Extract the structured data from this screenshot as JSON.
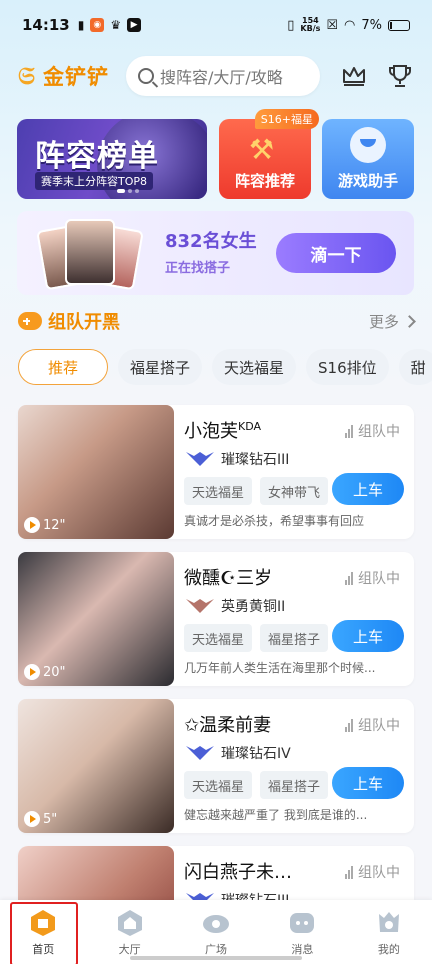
{
  "status_bar": {
    "time": "14:13",
    "speed_top": "154",
    "speed_bottom": "KB/s",
    "battery": "7%"
  },
  "header": {
    "app_name": "金铲铲",
    "search_placeholder": "搜阵容/大厅/攻略",
    "icons": [
      "crown-icon",
      "trophy-icon"
    ]
  },
  "banners": {
    "main_title": "阵容榜单",
    "main_sub": "赛季末上分阵容TOP8",
    "red_tag": "S16+福星",
    "red_label": "阵容推荐",
    "blue_label": "游戏助手"
  },
  "girls_card": {
    "count": "832名女生",
    "subtitle": "正在找搭子",
    "button": "滴一下"
  },
  "section": {
    "title": "组队开黑",
    "more": "更多"
  },
  "tabs": [
    "推荐",
    "福星搭子",
    "天选福星",
    "S16排位",
    "甜"
  ],
  "players": [
    {
      "name": "小泡芙",
      "name_sup": "KDA",
      "status": "组队中",
      "rank": "璀璨钻石III",
      "rank_color": "#4b5fd6",
      "chips": [
        "天选福星",
        "女神带飞"
      ],
      "button": "上车",
      "bio": "真诚才是必杀技，希望事事有回应",
      "duration": "12\""
    },
    {
      "name": "微醺☪三岁",
      "name_sup": "",
      "status": "组队中",
      "rank": "英勇黄铜II",
      "rank_color": "#b5746a",
      "chips": [
        "天选福星",
        "福星搭子"
      ],
      "button": "上车",
      "bio": "几万年前人类生活在海里那个时候...",
      "duration": "20\""
    },
    {
      "name": "✩温柔前妻",
      "name_sup": "",
      "status": "组队中",
      "rank": "璀璨钻石IV",
      "rank_color": "#4b5fd6",
      "chips": [
        "天选福星",
        "福星搭子"
      ],
      "button": "上车",
      "bio": "健忘越来越严重了 我到底是谁的...",
      "duration": "5\""
    },
    {
      "name": "闪白燕子未…",
      "name_sup": "",
      "status": "组队中",
      "rank": "璀璨钻石III",
      "rank_color": "#4b5fd6",
      "chips": [],
      "button": "",
      "bio": "",
      "duration": ""
    }
  ],
  "bottom_nav": [
    "首页",
    "大厅",
    "广场",
    "消息",
    "我的"
  ],
  "colors": {
    "brand_orange": "#f08c00",
    "accent_blue": "#1e88f5",
    "accent_purple": "#6a55f0",
    "active_highlight": "#e02020"
  }
}
